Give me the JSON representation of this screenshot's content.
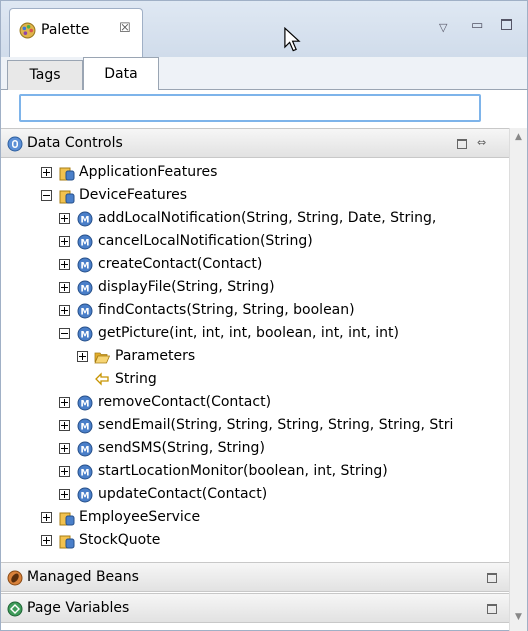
{
  "view": {
    "title": "Palette",
    "close_glyph": "☒",
    "menu_glyph": "▽",
    "minimize_glyph": "▭"
  },
  "tabs": [
    {
      "label": "Tags",
      "selected": false
    },
    {
      "label": "Data",
      "selected": true
    }
  ],
  "search": {
    "value": "",
    "placeholder": ""
  },
  "sections": {
    "data_controls": {
      "label": "Data Controls",
      "icon": "data-control-icon",
      "collapse_glyph": "⇔"
    },
    "managed_beans": {
      "label": "Managed Beans",
      "icon": "managed-bean-icon"
    },
    "page_variables": {
      "label": "Page Variables",
      "icon": "page-variable-icon"
    }
  },
  "tree": {
    "application_features": {
      "label": "ApplicationFeatures",
      "expanded": false
    },
    "device_features": {
      "label": "DeviceFeatures",
      "expanded": true,
      "methods": [
        {
          "label": "addLocalNotification(String, String, Date, String,",
          "expanded": false
        },
        {
          "label": "cancelLocalNotification(String)",
          "expanded": false
        },
        {
          "label": "createContact(Contact)",
          "expanded": false
        },
        {
          "label": "displayFile(String, String)",
          "expanded": false
        },
        {
          "label": "findContacts(String, String, boolean)",
          "expanded": false
        },
        {
          "label": "getPicture(int, int, int, boolean, int, int, int)",
          "expanded": true
        },
        {
          "label": "removeContact(Contact)",
          "expanded": false
        },
        {
          "label": "sendEmail(String, String, String, String, String, Stri",
          "expanded": false
        },
        {
          "label": "sendSMS(String, String)",
          "expanded": false
        },
        {
          "label": "startLocationMonitor(boolean, int, String)",
          "expanded": false
        },
        {
          "label": "updateContact(Contact)",
          "expanded": false
        }
      ],
      "get_picture_children": {
        "parameters": {
          "label": "Parameters",
          "expanded": false
        },
        "return_type": {
          "label": "String"
        }
      }
    },
    "employee_service": {
      "label": "EmployeeService",
      "expanded": false
    },
    "stock_quote": {
      "label": "StockQuote",
      "expanded": false
    }
  },
  "colors": {
    "header_bg": "#dfe8f3",
    "border": "#a0b0c6",
    "search_focus": "#7eb4ea",
    "method_icon": "#4a7fc9",
    "folder_icon": "#f2c24f",
    "return_icon": "#d9a400"
  }
}
